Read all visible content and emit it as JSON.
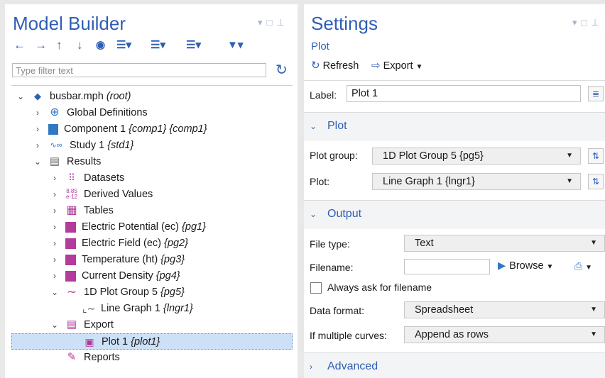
{
  "left": {
    "title": "Model Builder",
    "filter_placeholder": "Type filter text",
    "toolbar_icons": [
      "arrow-left-icon",
      "arrow-right-icon",
      "arrow-up-icon",
      "arrow-down-icon",
      "eye-icon",
      "expand-icon",
      "sort-icon",
      "list-icon",
      "pin-icon"
    ],
    "tree": [
      {
        "label": "busbar.mph",
        "tag": "(root)",
        "icon": "model-icon"
      },
      {
        "label": "Global Definitions",
        "tag": "",
        "icon": "globe-icon"
      },
      {
        "label": "Component 1",
        "tag": "{comp1} {comp1}",
        "icon": "cube-icon"
      },
      {
        "label": "Study 1",
        "tag": "{std1}",
        "icon": "study-icon"
      },
      {
        "label": "Results",
        "tag": "",
        "icon": "results-icon"
      },
      {
        "label": "Datasets",
        "tag": "",
        "icon": "grid-icon"
      },
      {
        "label": "Derived Values",
        "tag": "",
        "icon": "derived-values-icon"
      },
      {
        "label": "Tables",
        "tag": "",
        "icon": "table-icon"
      },
      {
        "label": "Electric Potential (ec)",
        "tag": "{pg1}",
        "icon": "plot-group-3d-icon"
      },
      {
        "label": "Electric Field (ec)",
        "tag": "{pg2}",
        "icon": "plot-group-3d-icon"
      },
      {
        "label": "Temperature (ht)",
        "tag": "{pg3}",
        "icon": "plot-group-3d-icon"
      },
      {
        "label": "Current Density",
        "tag": "{pg4}",
        "icon": "plot-group-3d-icon"
      },
      {
        "label": "1D Plot Group 5",
        "tag": "{pg5}",
        "icon": "plot-1d-icon"
      },
      {
        "label": "Line Graph 1",
        "tag": "{lngr1}",
        "icon": "line-graph-icon"
      },
      {
        "label": "Export",
        "tag": "",
        "icon": "export-icon"
      },
      {
        "label": "Plot 1",
        "tag": "{plot1}",
        "icon": "plot-export-icon"
      },
      {
        "label": "Reports",
        "tag": "",
        "icon": "reports-icon"
      }
    ],
    "derived_icon_text": [
      "8.85",
      "e-12"
    ]
  },
  "right": {
    "title": "Settings",
    "subtitle": "Plot",
    "refresh": "Refresh",
    "export": "Export",
    "label_caption": "Label:",
    "label_value": "Plot 1",
    "plot_section": "Plot",
    "plot_group_caption": "Plot group:",
    "plot_group_value": "1D Plot Group 5 {pg5}",
    "plot_caption": "Plot:",
    "plot_value": "Line Graph 1 {lngr1}",
    "output_section": "Output",
    "file_type_caption": "File type:",
    "file_type_value": "Text",
    "filename_caption": "Filename:",
    "filename_value": "",
    "browse": "Browse",
    "always_ask": "Always ask for filename",
    "data_format_caption": "Data format:",
    "data_format_value": "Spreadsheet",
    "multiple_curves_caption": "If multiple curves:",
    "multiple_curves_value": "Append as rows",
    "advanced_section": "Advanced"
  },
  "colors": {
    "accent": "#2f5eb5",
    "selection": "#cce0f7",
    "section_bg": "#f3f4f6"
  }
}
